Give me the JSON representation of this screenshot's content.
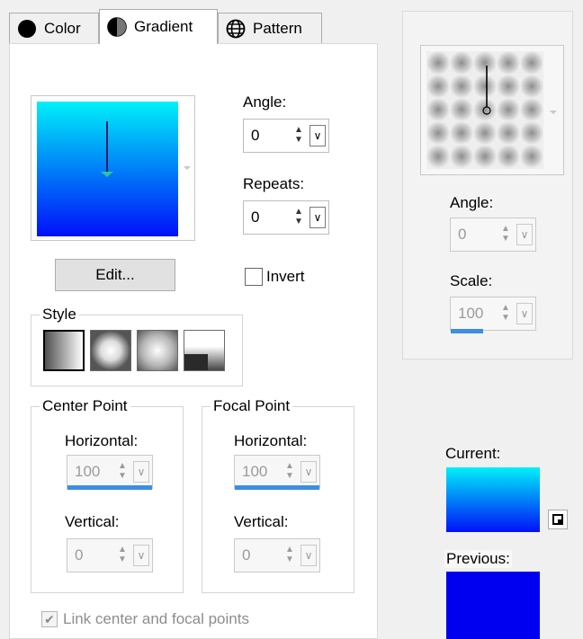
{
  "tabs": [
    {
      "label": "Color",
      "icon": "filled-circle-icon"
    },
    {
      "label": "Gradient",
      "icon": "half-circle-icon"
    },
    {
      "label": "Pattern",
      "icon": "globe-grid-icon"
    }
  ],
  "gradient": {
    "angle_label": "Angle:",
    "angle_value": "0",
    "repeats_label": "Repeats:",
    "repeats_value": "0",
    "edit_label": "Edit...",
    "invert_label": "Invert",
    "invert_checked": false,
    "style_label": "Style",
    "colors": {
      "top": "#00f0f8",
      "bottom": "#0010f8"
    }
  },
  "center_point": {
    "legend": "Center Point",
    "horizontal_label": "Horizontal:",
    "horizontal_value": "100",
    "vertical_label": "Vertical:",
    "vertical_value": "0"
  },
  "focal_point": {
    "legend": "Focal Point",
    "horizontal_label": "Horizontal:",
    "horizontal_value": "100",
    "vertical_label": "Vertical:",
    "vertical_value": "0"
  },
  "link_label": "Link center and focal points",
  "link_checked": true,
  "right_panel": {
    "angle_label": "Angle:",
    "angle_value": "0",
    "scale_label": "Scale:",
    "scale_value": "100",
    "current_label": "Current:",
    "previous_label": "Previous:",
    "previous_color": "#0000f0"
  }
}
